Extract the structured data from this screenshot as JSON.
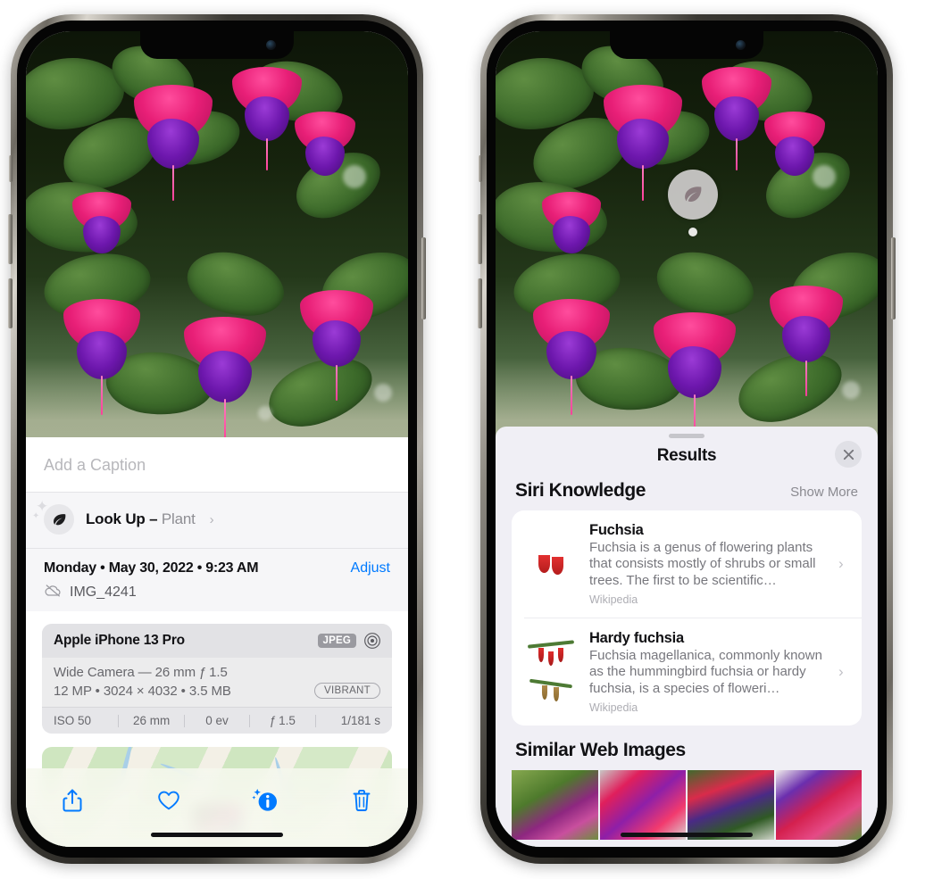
{
  "left_phone": {
    "caption_placeholder": "Add a Caption",
    "lookup": {
      "icon": "leaf-sparkle-icon",
      "label": "Look Up – ",
      "subject": "Plant",
      "chevron": "›"
    },
    "metadata": {
      "date_line": "Monday • May 30, 2022 • 9:23 AM",
      "adjust_label": "Adjust",
      "cloud_icon": "cloud-slash-icon",
      "filename": "IMG_4241"
    },
    "camera_card": {
      "model": "Apple iPhone 13 Pro",
      "format_badge": "JPEG",
      "aperture_icon": "aperture-icon",
      "lens_line": "Wide Camera — 26 mm ƒ 1.5",
      "resolution_line": "12 MP • 3024 × 4032 • 3.5 MB",
      "style_badge": "VIBRANT",
      "exif": [
        "ISO 50",
        "26 mm",
        "0 ev",
        "ƒ 1.5",
        "1/181 s"
      ]
    },
    "toolbar": {
      "share_icon": "share-icon",
      "favorite_icon": "heart-icon",
      "info_icon": "info-sparkle-icon",
      "delete_icon": "trash-icon",
      "accent_color": "#007aff"
    }
  },
  "right_phone": {
    "badge": {
      "icon": "leaf-icon",
      "name": "visual-look-up-badge"
    },
    "results": {
      "title": "Results",
      "close_icon": "close-icon",
      "siri_section": {
        "title": "Siri Knowledge",
        "action": "Show More",
        "items": [
          {
            "name": "Fuchsia",
            "description": "Fuchsia is a genus of flowering plants that consists mostly of shrubs or small trees. The first to be scientific…",
            "source": "Wikipedia"
          },
          {
            "name": "Hardy fuchsia",
            "description": "Fuchsia magellanica, commonly known as the hummingbird fuchsia or hardy fuchsia, is a species of floweri…",
            "source": "Wikipedia"
          }
        ]
      },
      "web_section": {
        "title": "Similar Web Images",
        "thumbnails": [
          "fuchsia-thumb-1",
          "fuchsia-thumb-2",
          "fuchsia-thumb-3",
          "fuchsia-thumb-4"
        ]
      }
    }
  }
}
